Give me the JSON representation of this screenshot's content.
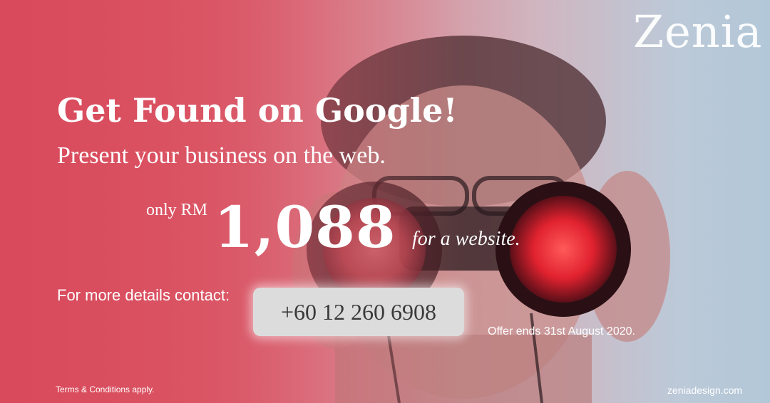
{
  "brand": {
    "logo_text": "Zenia"
  },
  "headline": "Get Found on Google!",
  "subhead": "Present your business on the web.",
  "price": {
    "prefix": "only RM",
    "amount": "1,088",
    "suffix": "for a website."
  },
  "contact": {
    "label": "For more details contact:",
    "phone": "+60 12 260 6908"
  },
  "offer": "Offer ends 31st August 2020.",
  "footer": {
    "terms": "Terms & Conditions apply.",
    "website": "zeniadesign.com"
  },
  "colors": {
    "primary_red": "#d94a5c",
    "light_blue": "#b2c8d8",
    "phone_box": "#dcdcdc",
    "lens_red": "#e1222f"
  }
}
